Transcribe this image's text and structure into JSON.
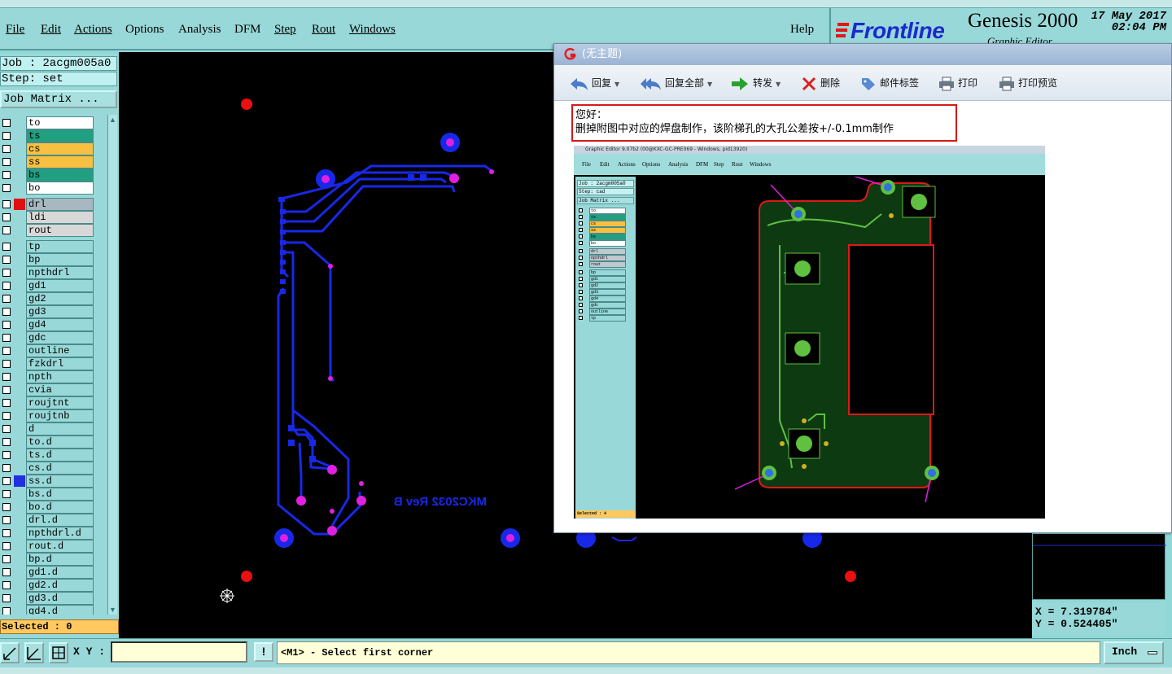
{
  "menu": {
    "items": [
      "File",
      "Edit",
      "Actions",
      "Options",
      "Analysis",
      "DFM",
      "Step",
      "Rout",
      "Windows"
    ],
    "help": "Help"
  },
  "brand": {
    "logo": "Frontline",
    "product": "Genesis 2000",
    "subtitle": "Graphic Editor",
    "date": "17 May 2017",
    "time": "02:04 PM"
  },
  "left": {
    "job": "Job : 2acgm005a0",
    "step": "Step: set",
    "job_matrix": "Job Matrix ...",
    "selected": "Selected : 0",
    "layers": [
      {
        "name": "to",
        "bg": "#ffffff",
        "swatch": ""
      },
      {
        "name": "ts",
        "bg": "#20a080",
        "swatch": ""
      },
      {
        "name": "cs",
        "bg": "#f8c040",
        "swatch": ""
      },
      {
        "name": "ss",
        "bg": "#f8c040",
        "swatch": ""
      },
      {
        "name": "bs",
        "bg": "#20a080",
        "swatch": ""
      },
      {
        "name": "bo",
        "bg": "#ffffff",
        "swatch": ""
      },
      {
        "name": "drl",
        "bg": "#a8b8c0",
        "swatch": "#e01010"
      },
      {
        "name": "ldi",
        "bg": "#d8d8d8",
        "swatch": ""
      },
      {
        "name": "rout",
        "bg": "#d8d8d8",
        "swatch": ""
      },
      {
        "name": "tp",
        "bg": "#98d8d8",
        "swatch": ""
      },
      {
        "name": "bp",
        "bg": "#98d8d8",
        "swatch": ""
      },
      {
        "name": "npthdrl",
        "bg": "#98d8d8",
        "swatch": ""
      },
      {
        "name": "gd1",
        "bg": "#98d8d8",
        "swatch": ""
      },
      {
        "name": "gd2",
        "bg": "#98d8d8",
        "swatch": ""
      },
      {
        "name": "gd3",
        "bg": "#98d8d8",
        "swatch": ""
      },
      {
        "name": "gd4",
        "bg": "#98d8d8",
        "swatch": ""
      },
      {
        "name": "gdc",
        "bg": "#98d8d8",
        "swatch": ""
      },
      {
        "name": "outline",
        "bg": "#98d8d8",
        "swatch": ""
      },
      {
        "name": "fzkdrl",
        "bg": "#98d8d8",
        "swatch": ""
      },
      {
        "name": "npth",
        "bg": "#98d8d8",
        "swatch": ""
      },
      {
        "name": "cvia",
        "bg": "#98d8d8",
        "swatch": ""
      },
      {
        "name": "roujtnt",
        "bg": "#98d8d8",
        "swatch": ""
      },
      {
        "name": "roujtnb",
        "bg": "#98d8d8",
        "swatch": ""
      },
      {
        "name": "d",
        "bg": "#98d8d8",
        "swatch": ""
      },
      {
        "name": "to.d",
        "bg": "#98d8d8",
        "swatch": ""
      },
      {
        "name": "ts.d",
        "bg": "#98d8d8",
        "swatch": ""
      },
      {
        "name": "cs.d",
        "bg": "#98d8d8",
        "swatch": ""
      },
      {
        "name": "ss.d",
        "bg": "#98d8d8",
        "swatch": "#2030e0"
      },
      {
        "name": "bs.d",
        "bg": "#98d8d8",
        "swatch": ""
      },
      {
        "name": "bo.d",
        "bg": "#98d8d8",
        "swatch": ""
      },
      {
        "name": "drl.d",
        "bg": "#98d8d8",
        "swatch": ""
      },
      {
        "name": "npthdrl.d",
        "bg": "#98d8d8",
        "swatch": ""
      },
      {
        "name": "rout.d",
        "bg": "#98d8d8",
        "swatch": ""
      },
      {
        "name": "bp.d",
        "bg": "#98d8d8",
        "swatch": ""
      },
      {
        "name": "gd1.d",
        "bg": "#98d8d8",
        "swatch": ""
      },
      {
        "name": "gd2.d",
        "bg": "#98d8d8",
        "swatch": ""
      },
      {
        "name": "gd3.d",
        "bg": "#98d8d8",
        "swatch": ""
      },
      {
        "name": "gd4.d",
        "bg": "#98d8d8",
        "swatch": ""
      }
    ]
  },
  "canvas": {
    "board_text": "MKC2032 Rev B"
  },
  "email": {
    "title": "(无主题)",
    "toolbar": {
      "reply": "回复",
      "reply_all": "回复全部",
      "forward": "转发",
      "delete": "删除",
      "tag": "邮件标签",
      "print": "打印",
      "preview": "打印预览"
    },
    "greeting": "您好：",
    "message": "删掉附图中对应的焊盘制作，该阶梯孔的大孔公差按+/-0.1mm制作",
    "screenshot": {
      "title": "Graphic Editor 9.07b2 (00@KXC-GC-PRE069 - Windows, pid13920)",
      "menu": [
        "File",
        "Edit",
        "Actions",
        "Options",
        "Analysis",
        "DFM",
        "Step",
        "Rout",
        "Windows"
      ],
      "job": "Job : 2acgm005a0",
      "step": "Step: cad",
      "job_matrix": "Job Matrix ...",
      "layers": [
        "to",
        "ts",
        "cs",
        "ss",
        "bs",
        "bo",
        "drl",
        "npthdrl",
        "rout",
        "bp",
        "gd1",
        "gd2",
        "gd3",
        "gd4",
        "gdc",
        "outline",
        "tp"
      ],
      "selected": "Selected : 4"
    }
  },
  "coords": {
    "x": "X = 7.319784\"",
    "y": "Y = 0.524405\""
  },
  "bottom": {
    "xy_label": "X Y :",
    "xy_value": "",
    "alert": "!",
    "prompt": "<M1> - Select first corner",
    "unit": "Inch"
  },
  "colors": {
    "trace": "#1828e8",
    "pad_magenta": "#e020e0",
    "drill_red": "#e81010",
    "ui_teal": "#98d8d8"
  }
}
